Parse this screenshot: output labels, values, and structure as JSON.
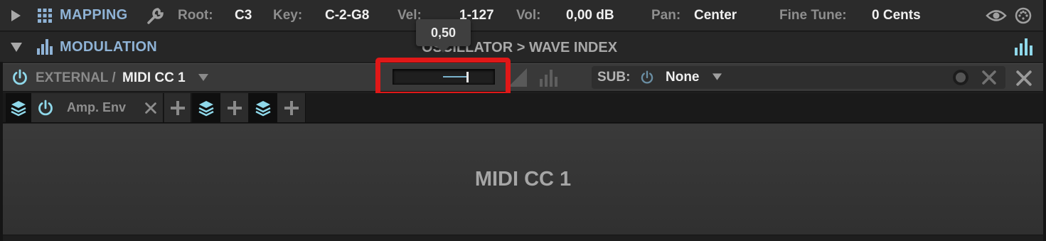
{
  "mapping": {
    "title": "MAPPING",
    "root_label": "Root:",
    "root_value": "C3",
    "key_label": "Key:",
    "key_value": "C-2-G8",
    "vel_label": "Vel:",
    "vel_value": "1-127",
    "vol_label": "Vol:",
    "vol_value": "0,00 dB",
    "pan_label": "Pan:",
    "pan_value": "Center",
    "fine_tune_label": "Fine Tune:",
    "fine_tune_value": "0 Cents"
  },
  "modulation": {
    "title": "MODULATION",
    "destination": "OSCILLATOR > WAVE INDEX"
  },
  "external": {
    "category": "EXTERNAL /",
    "source": "MIDI CC 1",
    "amount": 0.5,
    "tooltip": "0,50",
    "sub_label": "SUB:",
    "sub_value": "None"
  },
  "tabs": {
    "amp_env": "Amp. Env"
  },
  "content": {
    "title": "MIDI CC 1"
  },
  "colors": {
    "accent_blue": "#8fb3d6",
    "icon_cyan": "#8fd8ea",
    "highlight_red": "#e01818"
  }
}
